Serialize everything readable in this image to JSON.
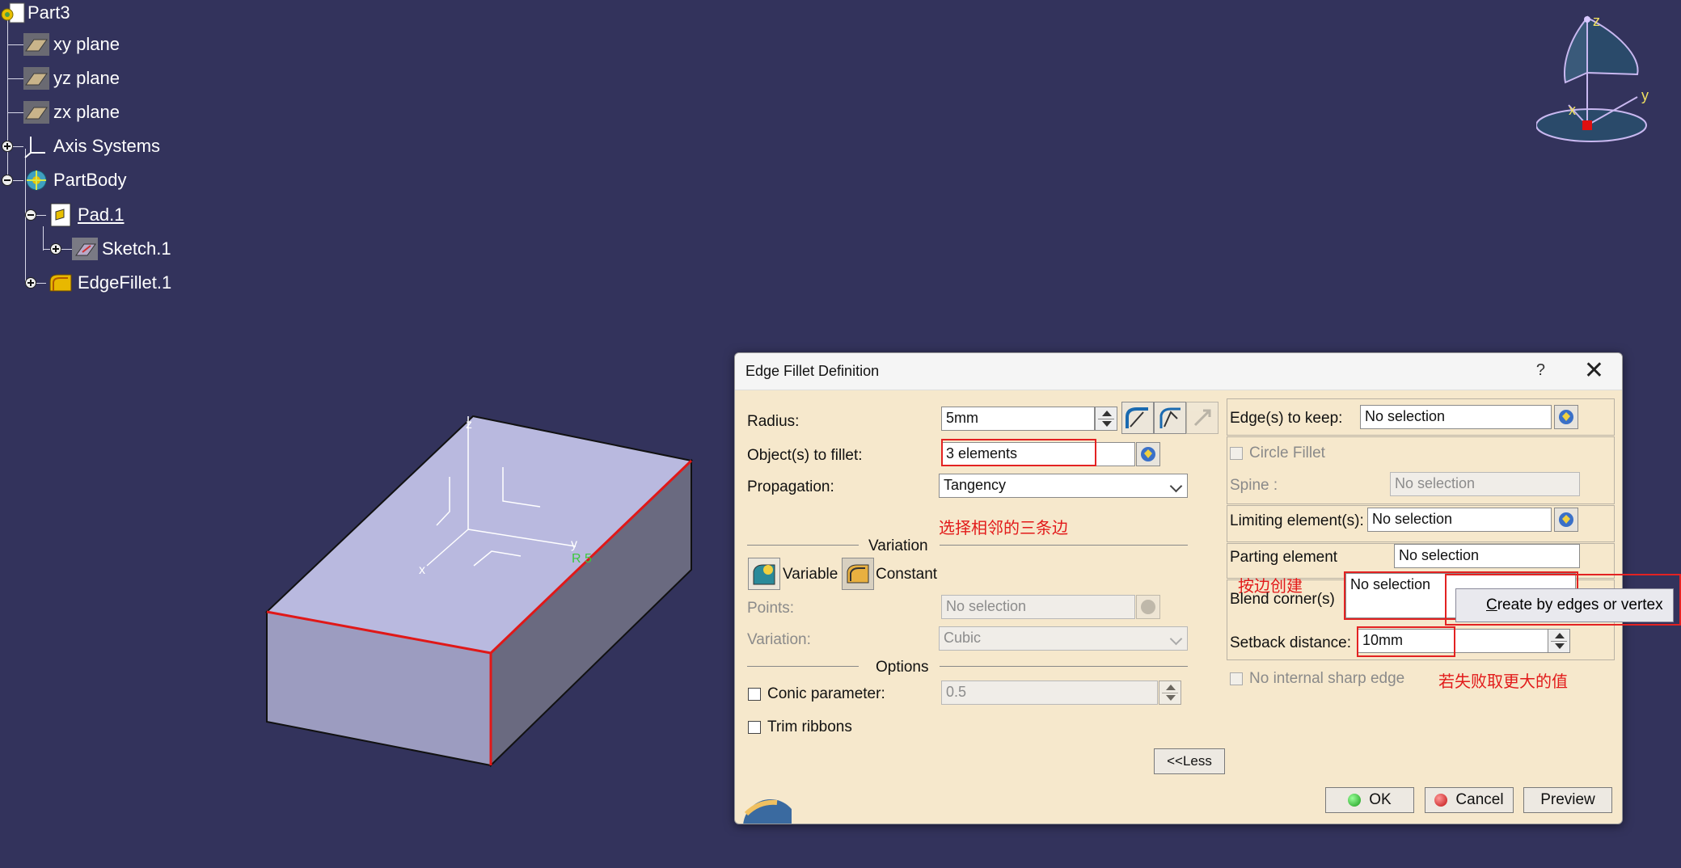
{
  "tree": {
    "root": "Part3",
    "items": [
      {
        "label": "xy plane"
      },
      {
        "label": "yz plane"
      },
      {
        "label": "zx plane"
      },
      {
        "label": "Axis Systems"
      },
      {
        "label": "PartBody"
      },
      {
        "label": "Pad.1"
      },
      {
        "label": "Sketch.1"
      },
      {
        "label": "EdgeFillet.1"
      }
    ]
  },
  "compass": {
    "z": "z",
    "y": "y",
    "x": "x"
  },
  "model_axes": {
    "z": "z",
    "y": "y",
    "x": "x",
    "tag": "R 5"
  },
  "dialog": {
    "title": "Edge Fillet Definition",
    "help": "?",
    "close": "✕",
    "radius_label": "Radius:",
    "radius_value": "5mm",
    "objects_label": "Object(s) to fillet:",
    "objects_value": "3 elements",
    "propagation_label": "Propagation:",
    "propagation_value": "Tangency",
    "variation_section": "Variation",
    "variable_label": "Variable",
    "constant_label": "Constant",
    "points_label": "Points:",
    "points_value": "No selection",
    "variation_label": "Variation:",
    "variation_value": "Cubic",
    "options_section": "Options",
    "conic_label": "Conic parameter:",
    "conic_value": "0.5",
    "trim_label": "Trim ribbons",
    "less_button": "<<Less",
    "edges_keep_label": "Edge(s) to keep:",
    "edges_keep_value": "No selection",
    "circle_fillet_label": "Circle Fillet",
    "spine_label": "Spine :",
    "spine_value": "No selection",
    "limiting_label": "Limiting element(s):",
    "limiting_value": "No selection",
    "parting_label": "Parting element",
    "parting_value": "No selection",
    "blend_label": "Blend corner(s)",
    "blend_value": "No selection",
    "setback_label": "Setback distance:",
    "setback_value": "10mm",
    "no_internal_label": "No internal sharp edge",
    "ok": "OK",
    "cancel": "Cancel",
    "preview": "Preview"
  },
  "context_menu": {
    "underlined": "C",
    "rest": "reate by edges or vertex"
  },
  "annotations": {
    "select_edges": "选择相邻的三条边",
    "create_by_edge": "按边创建",
    "retry_larger": "若失败取更大的值"
  },
  "colors": {
    "background": "#33335c",
    "dialog": "#f6e8cc",
    "annotation_red": "#e21a1a",
    "edge_highlight": "#e01818"
  }
}
